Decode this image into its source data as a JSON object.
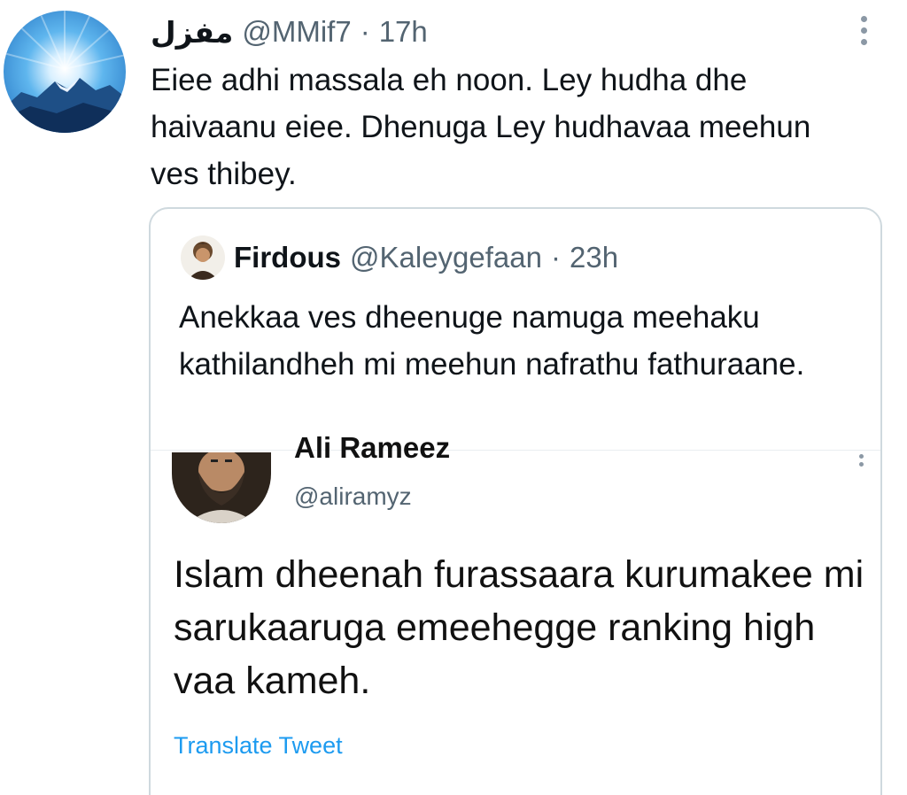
{
  "tweet": {
    "display_name": "مفزل",
    "handle": "@MMif7",
    "separator": "·",
    "time": "17h",
    "text": "Eiee adhi massala eh noon. Ley hudha dhe haivaanu eiee. Dhenuga Ley hudhavaa meehun ves thibey.",
    "more_icon": "vertical-dots-icon"
  },
  "quoted": {
    "display_name": "Firdous",
    "handle": "@Kaleygefaan",
    "separator": "·",
    "time": "23h",
    "text": "Anekkaa ves dheenuge namuga meehaku kathilandheh mi meehun nafrathu fathuraane."
  },
  "embedded": {
    "display_name": "Ali Rameez",
    "handle": "@aliramyz",
    "text": "Islam dheenah furassaara kurumakee mi sarukaaruga emeehegge ranking high vaa kameh.",
    "translate_label": "Translate Tweet",
    "more_icon": "vertical-dots-icon"
  },
  "colors": {
    "text": "#0f1419",
    "secondary": "#536471",
    "border": "#cfd9de",
    "link": "#1d9bf0"
  }
}
